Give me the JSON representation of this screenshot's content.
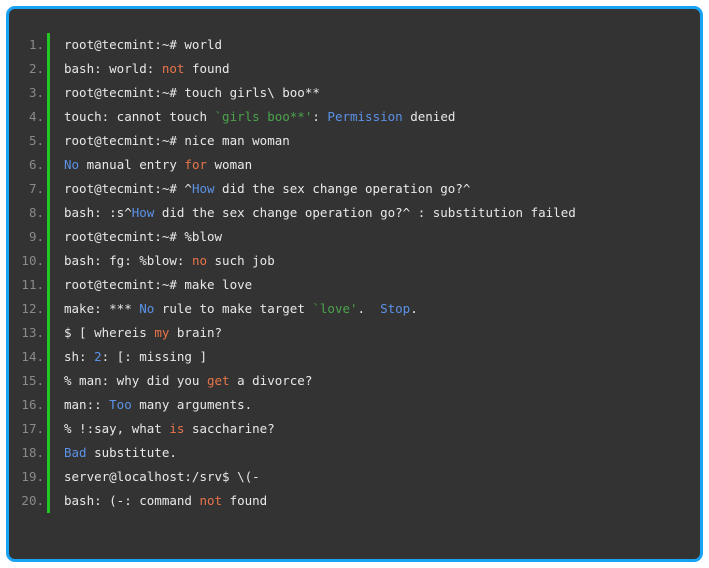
{
  "window": {
    "title": "terminal-output-code-block",
    "background_color": "#ffffff",
    "frame_border_color": "#19a3f5",
    "code_background_color": "#333333",
    "gutter_bar_color": "#23c723",
    "line_number_color": "#8a8a8a",
    "default_text_color": "#e8e8e8"
  },
  "palette": {
    "orange": "#e9744a",
    "blue": "#5b92e8",
    "green": "#4ba34b",
    "plain": "#e8e8e8"
  },
  "code_block": {
    "language_hint": "shell-session",
    "line_count": 20,
    "lines": [
      {
        "number": "1.",
        "plain": "root@tecmint:~# world",
        "tokens": [
          {
            "text": "root@tecmint:~# world",
            "color": "plain"
          }
        ]
      },
      {
        "number": "2.",
        "plain": "bash: world: not found",
        "tokens": [
          {
            "text": "bash: world: ",
            "color": "plain"
          },
          {
            "text": "not",
            "color": "orange"
          },
          {
            "text": " found",
            "color": "plain"
          }
        ]
      },
      {
        "number": "3.",
        "plain": "root@tecmint:~# touch girls\\ boo**",
        "tokens": [
          {
            "text": "root@tecmint:~# touch girls\\ boo**",
            "color": "plain"
          }
        ]
      },
      {
        "number": "4.",
        "plain": "touch: cannot touch `girls boo**': Permission denied",
        "tokens": [
          {
            "text": "touch: cannot touch ",
            "color": "plain"
          },
          {
            "text": "`girls boo**'",
            "color": "green"
          },
          {
            "text": ": ",
            "color": "plain"
          },
          {
            "text": "Permission",
            "color": "blue"
          },
          {
            "text": " denied",
            "color": "plain"
          }
        ]
      },
      {
        "number": "5.",
        "plain": "root@tecmint:~# nice man woman",
        "tokens": [
          {
            "text": "root@tecmint:~# nice man woman",
            "color": "plain"
          }
        ]
      },
      {
        "number": "6.",
        "plain": "No manual entry for woman",
        "tokens": [
          {
            "text": "No",
            "color": "blue"
          },
          {
            "text": " manual entry ",
            "color": "plain"
          },
          {
            "text": "for",
            "color": "orange"
          },
          {
            "text": " woman",
            "color": "plain"
          }
        ]
      },
      {
        "number": "7.",
        "plain": "root@tecmint:~# ^How did the sex change operation go?^",
        "tokens": [
          {
            "text": "root@tecmint:~# ^",
            "color": "plain"
          },
          {
            "text": "How",
            "color": "blue"
          },
          {
            "text": " did the sex change operation go?^",
            "color": "plain"
          }
        ]
      },
      {
        "number": "8.",
        "plain": "bash: :s^How did the sex change operation go?^ : substitution failed",
        "tokens": [
          {
            "text": "bash: :s^",
            "color": "plain"
          },
          {
            "text": "How",
            "color": "blue"
          },
          {
            "text": " did the sex change operation go?^ : substitution failed",
            "color": "plain"
          }
        ]
      },
      {
        "number": "9.",
        "plain": "root@tecmint:~# %blow",
        "tokens": [
          {
            "text": "root@tecmint:~# %blow",
            "color": "plain"
          }
        ]
      },
      {
        "number": "10.",
        "plain": "bash: fg: %blow: no such job",
        "tokens": [
          {
            "text": "bash: fg: %blow: ",
            "color": "plain"
          },
          {
            "text": "no",
            "color": "orange"
          },
          {
            "text": " such job",
            "color": "plain"
          }
        ]
      },
      {
        "number": "11.",
        "plain": "root@tecmint:~# make love",
        "tokens": [
          {
            "text": "root@tecmint:~# make love",
            "color": "plain"
          }
        ]
      },
      {
        "number": "12.",
        "plain": "make: *** No rule to make target `love'.  Stop.",
        "tokens": [
          {
            "text": "make: *** ",
            "color": "plain"
          },
          {
            "text": "No",
            "color": "blue"
          },
          {
            "text": " rule to make target ",
            "color": "plain"
          },
          {
            "text": "`love'",
            "color": "green"
          },
          {
            "text": ".  ",
            "color": "plain"
          },
          {
            "text": "Stop",
            "color": "blue"
          },
          {
            "text": ".",
            "color": "plain"
          }
        ]
      },
      {
        "number": "13.",
        "plain": "$ [ whereis my brain?",
        "tokens": [
          {
            "text": "$ [ whereis ",
            "color": "plain"
          },
          {
            "text": "my",
            "color": "orange"
          },
          {
            "text": " brain?",
            "color": "plain"
          }
        ]
      },
      {
        "number": "14.",
        "plain": "sh: 2: [: missing ]",
        "tokens": [
          {
            "text": "sh: ",
            "color": "plain"
          },
          {
            "text": "2",
            "color": "blue"
          },
          {
            "text": ": [: missing ]",
            "color": "plain"
          }
        ]
      },
      {
        "number": "15.",
        "plain": "% man: why did you get a divorce?",
        "tokens": [
          {
            "text": "% man: why did you ",
            "color": "plain"
          },
          {
            "text": "get",
            "color": "orange"
          },
          {
            "text": " a divorce?",
            "color": "plain"
          }
        ]
      },
      {
        "number": "16.",
        "plain": "man:: Too many arguments.",
        "tokens": [
          {
            "text": "man:: ",
            "color": "plain"
          },
          {
            "text": "Too",
            "color": "blue"
          },
          {
            "text": " many arguments.",
            "color": "plain"
          }
        ]
      },
      {
        "number": "17.",
        "plain": "% !:say, what is saccharine?",
        "tokens": [
          {
            "text": "% !:say, what ",
            "color": "plain"
          },
          {
            "text": "is",
            "color": "orange"
          },
          {
            "text": " saccharine?",
            "color": "plain"
          }
        ]
      },
      {
        "number": "18.",
        "plain": "Bad substitute.",
        "tokens": [
          {
            "text": "Bad",
            "color": "blue"
          },
          {
            "text": " substitute.",
            "color": "plain"
          }
        ]
      },
      {
        "number": "19.",
        "plain": "server@localhost:/srv$ \\(-",
        "tokens": [
          {
            "text": "server@localhost:/srv$ \\(-",
            "color": "plain"
          }
        ]
      },
      {
        "number": "20.",
        "plain": "bash: (-: command not found",
        "tokens": [
          {
            "text": "bash: (-: command ",
            "color": "plain"
          },
          {
            "text": "not",
            "color": "orange"
          },
          {
            "text": " found",
            "color": "plain"
          }
        ]
      }
    ]
  }
}
